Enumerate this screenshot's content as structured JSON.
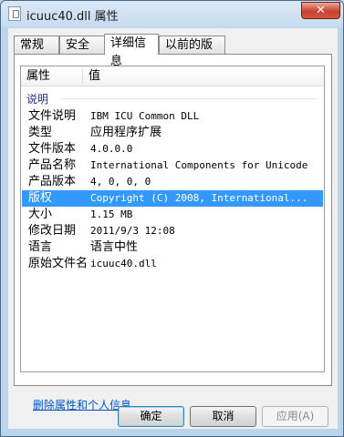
{
  "window": {
    "title": "icuuc40.dll 属性",
    "close_label": "✕"
  },
  "tabs": [
    {
      "label": "常规"
    },
    {
      "label": "安全"
    },
    {
      "label": "详细信息"
    },
    {
      "label": "以前的版本"
    }
  ],
  "columns": {
    "property": "属性",
    "value": "值"
  },
  "group": "说明",
  "rows": [
    {
      "key": "文件说明",
      "value": "IBM ICU Common DLL"
    },
    {
      "key": "类型",
      "value": "应用程序扩展"
    },
    {
      "key": "文件版本",
      "value": "4.0.0.0"
    },
    {
      "key": "产品名称",
      "value": "International Components for Unicode"
    },
    {
      "key": "产品版本",
      "value": "4, 0, 0, 0"
    },
    {
      "key": "版权",
      "value": "Copyright (C) 2008, International..."
    },
    {
      "key": "大小",
      "value": "1.15 MB"
    },
    {
      "key": "修改日期",
      "value": "2011/9/3 12:08"
    },
    {
      "key": "语言",
      "value": "语言中性"
    },
    {
      "key": "原始文件名",
      "value": "icuuc40.dll"
    }
  ],
  "link": "删除属性和个人信息",
  "buttons": {
    "ok": "确定",
    "cancel": "取消",
    "apply": "应用(A)"
  },
  "colors": {
    "selection": "#3399ff",
    "link": "#0055cc",
    "close": "#c8422f"
  }
}
